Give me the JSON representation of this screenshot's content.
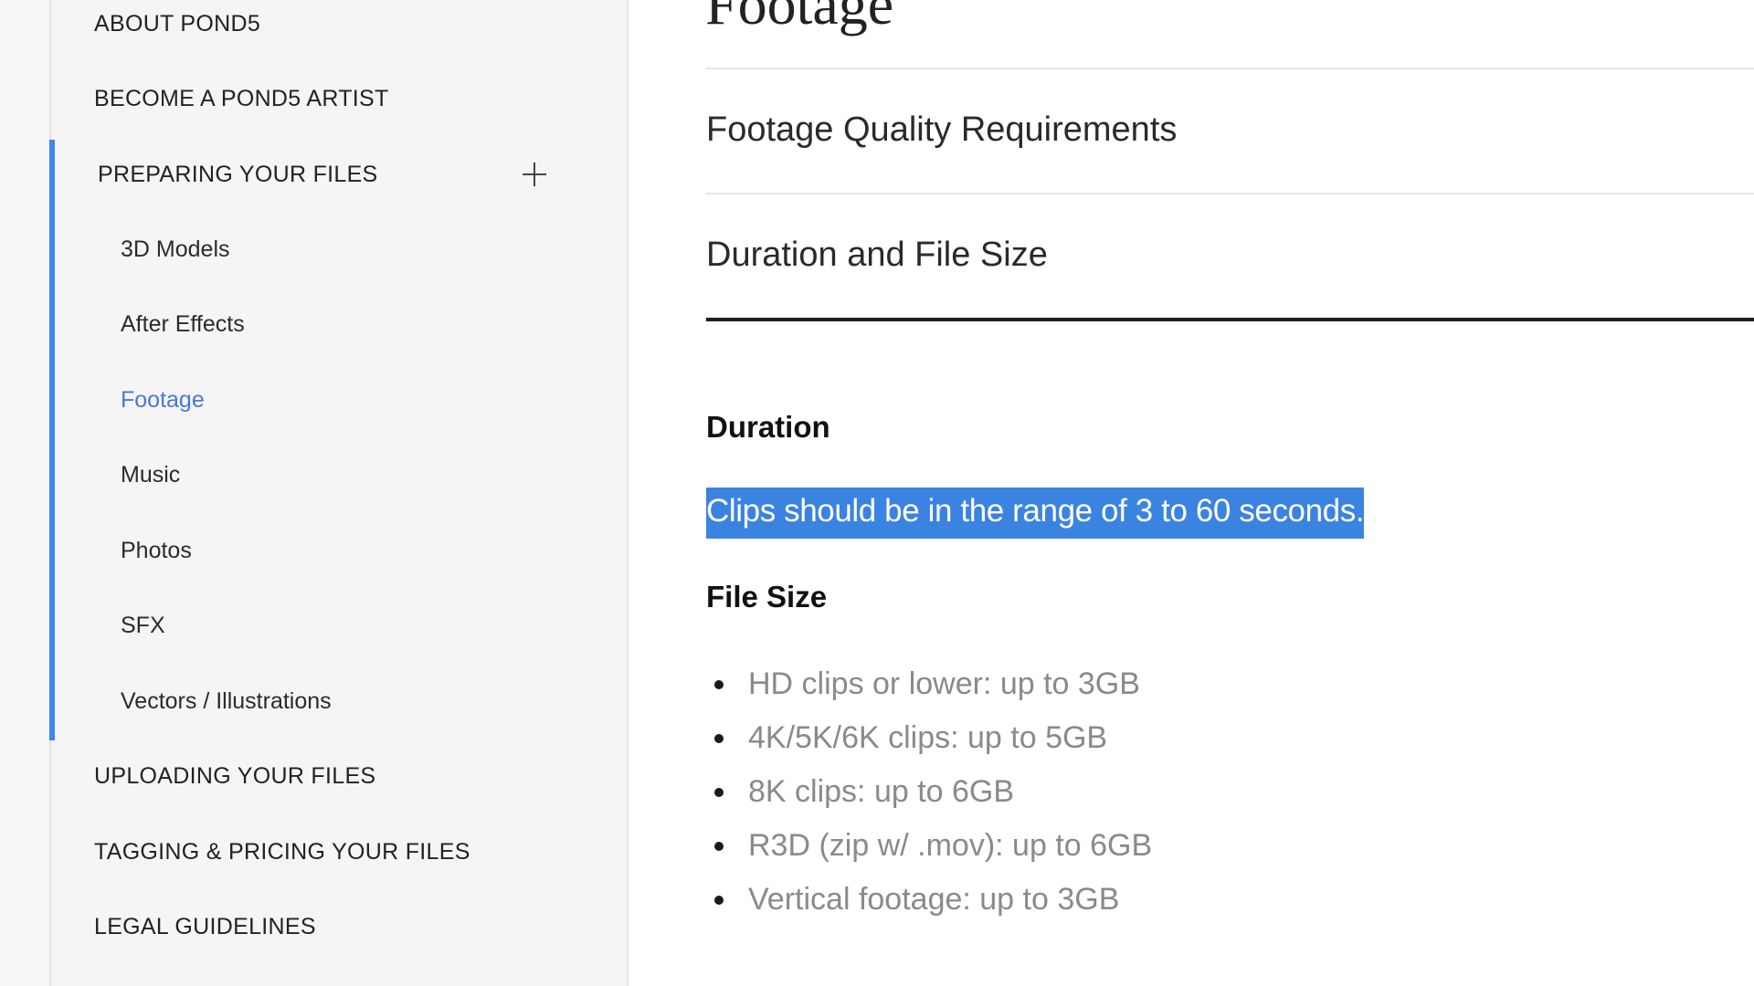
{
  "sidebar": {
    "sections_before": [
      {
        "id": "about",
        "label": "ABOUT POND5"
      },
      {
        "id": "become-artist",
        "label": "BECOME A POND5 ARTIST"
      }
    ],
    "expanded_section": {
      "label": "PREPARING YOUR FILES",
      "toggle_icon": "plus-icon"
    },
    "sub_items": [
      {
        "label": "3D Models",
        "active": false
      },
      {
        "label": "After Effects",
        "active": false
      },
      {
        "label": "Footage",
        "active": true
      },
      {
        "label": "Music",
        "active": false
      },
      {
        "label": "Photos",
        "active": false
      },
      {
        "label": "SFX",
        "active": false
      },
      {
        "label": "Vectors / Illustrations",
        "active": false
      }
    ],
    "sections_after": [
      {
        "id": "uploading",
        "label": "UPLOADING YOUR FILES"
      },
      {
        "id": "tagging",
        "label": "TAGGING & PRICING YOUR FILES"
      },
      {
        "id": "legal",
        "label": "LEGAL GUIDELINES"
      }
    ]
  },
  "main": {
    "page_title": "Footage",
    "accordions": [
      {
        "label": "Footage Quality Requirements",
        "expanded": false
      },
      {
        "label": "Duration and File Size",
        "expanded": true
      }
    ],
    "duration": {
      "heading": "Duration",
      "selected_text": "Clips should be in the range of 3 to 60 seconds."
    },
    "file_size": {
      "heading": "File Size",
      "items": [
        "HD clips or lower: up to 3GB",
        "4K/5K/6K clips: up to 5GB",
        "8K clips: up to 6GB",
        "R3D (zip w/ .mov): up to 6GB",
        "Vertical footage: up to 3GB"
      ]
    }
  },
  "colors": {
    "accent": "#3f87f5",
    "active_link": "#4a78d6",
    "selection": "#3b83e0",
    "muted_text": "#8a8a8a"
  }
}
